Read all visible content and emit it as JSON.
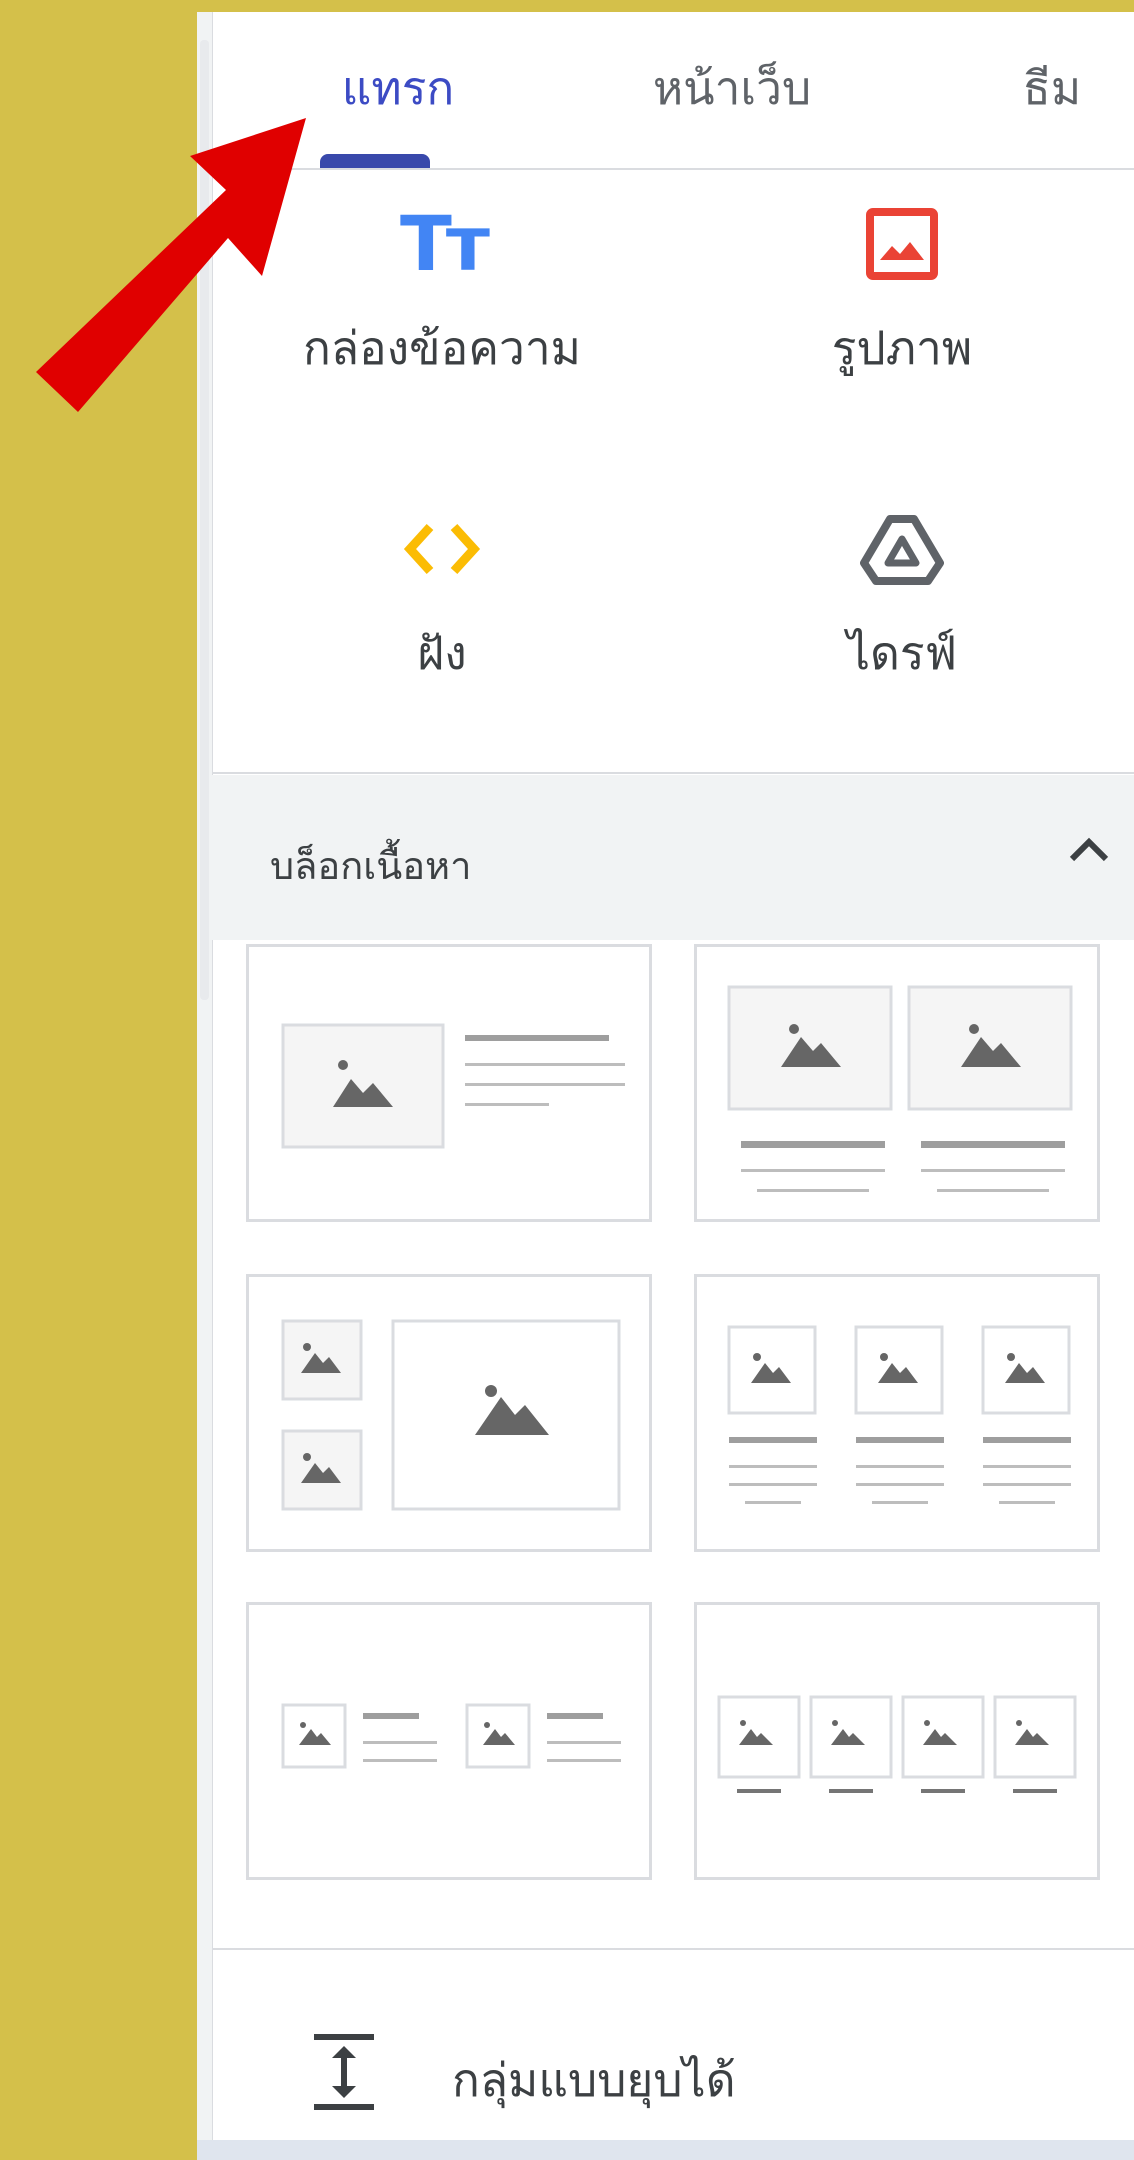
{
  "tabs": {
    "insert": "แทรก",
    "pages": "หน้าเว็บ",
    "themes": "ธีม"
  },
  "insert_items": {
    "text_box": "กล่องข้อความ",
    "text_box_icon_text": "Tт",
    "images": "รูปภาพ",
    "embed": "ฝัง",
    "drive": "ไดรฟ์"
  },
  "content_blocks": {
    "title": "บล็อกเนื้อหา"
  },
  "collapsible_group": "กลุ่มแบบยุบได้",
  "colors": {
    "background": "#d4c04a",
    "accent": "#3c4bc4",
    "text_box_icon": "#4285f4",
    "image_icon": "#ea4335",
    "embed_icon": "#fbbc04",
    "arrow": "#e00000"
  }
}
